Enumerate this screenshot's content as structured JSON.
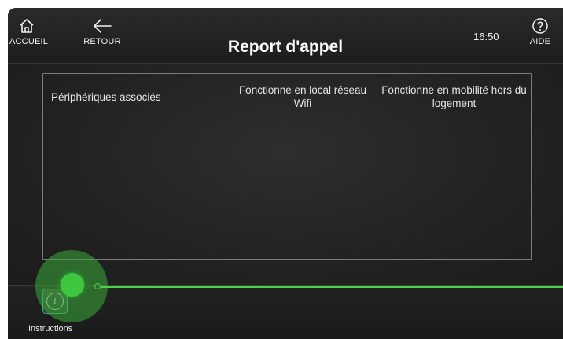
{
  "header": {
    "title": "Report d'appel",
    "time": "16:50",
    "home_label": "ACCUEIL",
    "back_label": "RETOUR",
    "help_label": "AIDE"
  },
  "table": {
    "columns": [
      "Périphériques associés",
      "Fonctionne en local réseau Wifi",
      "Fonctionne en mobilité hors du logement"
    ],
    "rows": []
  },
  "footer": {
    "instructions_label": "Instructions"
  },
  "colors": {
    "accent": "#3cc83c",
    "background": "#1f1f1f"
  }
}
